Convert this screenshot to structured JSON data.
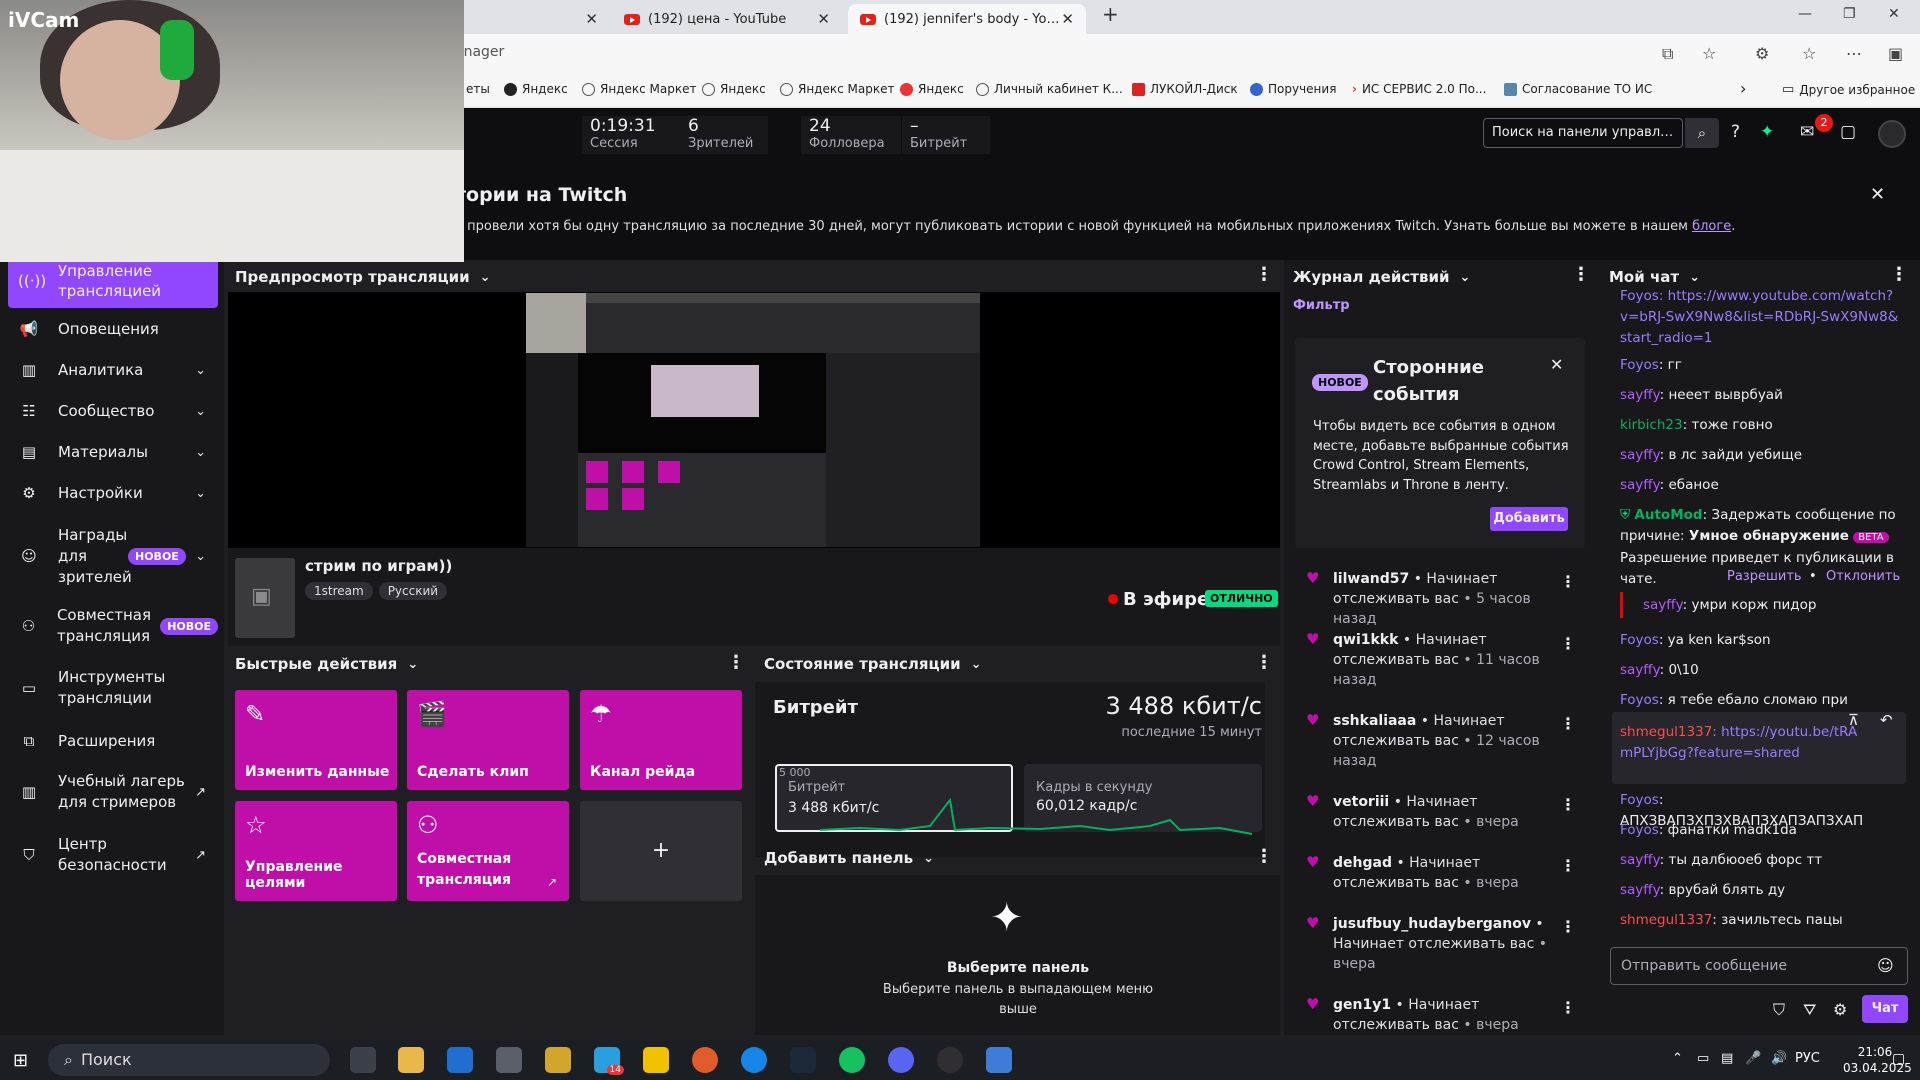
{
  "browser": {
    "tabs": [
      {
        "label": "(192) цена - YouTube"
      },
      {
        "label": "(192) jennifer's body - YouTube"
      }
    ],
    "address_partial": "anager",
    "bookmarks": [
      "еты",
      "Яндекс",
      "Яндекс Маркет",
      "Яндекс",
      "Яндекс Маркет",
      "Яндекс",
      "Личный кабинет К...",
      "ЛУКОЙЛ-Диск",
      "Поручения",
      "ИС СЕРВИС 2.0 По...",
      "Согласование ТО ИС",
      "Другое избранное"
    ]
  },
  "webcam_overlay": "iVCam",
  "stats": [
    {
      "value": "0:19:31",
      "label": "Сессия"
    },
    {
      "value": "6",
      "label": "Зрителей"
    },
    {
      "value": "24",
      "label": "Фолловера"
    },
    {
      "value": "–",
      "label": "Битрейт"
    }
  ],
  "search_placeholder": "Поиск на панели управлени",
  "notifications_count": "2",
  "banner": {
    "title": "тории на Twitch",
    "text": "е провели хотя бы одну трансляцию за последние 30 дней, могут публиковать истории с новой функцией на мобильных приложениях Twitch. Узнать больше вы можете в нашем",
    "link": "блоге",
    "after": "."
  },
  "sidebar": [
    {
      "label": "Управление трансляцией",
      "icon": "broadcast-icon",
      "active": true
    },
    {
      "label": "Оповещения",
      "icon": "megaphone-icon"
    },
    {
      "label": "Аналитика",
      "icon": "analytics-icon",
      "expand": true
    },
    {
      "label": "Сообщество",
      "icon": "community-icon",
      "expand": true
    },
    {
      "label": "Материалы",
      "icon": "content-icon",
      "expand": true
    },
    {
      "label": "Настройки",
      "icon": "gear-icon",
      "expand": true
    },
    {
      "label": "Награды для зрителей",
      "icon": "rewards-icon",
      "badge": "НОВОЕ",
      "expand": true
    },
    {
      "label": "Совместная трансляция",
      "icon": "collab-icon",
      "badge": "НОВОЕ"
    },
    {
      "label": "Инструменты трансляции",
      "icon": "tools-icon"
    },
    {
      "label": "Расширения",
      "icon": "extensions-icon"
    },
    {
      "label": "Учебный лагерь для стримеров",
      "icon": "book-icon",
      "external": true
    },
    {
      "label": "Центр безопасности",
      "icon": "shield-icon",
      "external": true
    }
  ],
  "preview": {
    "header": "Предпросмотр трансляции"
  },
  "stream": {
    "title": "стрим по играм))",
    "tags": [
      "1stream",
      "Русский"
    ],
    "live_label": "В эфире",
    "live_badge": "ОТЛИЧНО"
  },
  "quick_actions": {
    "header": "Быстрые действия",
    "items": [
      {
        "label": "Изменить данные",
        "icon": "pencil-icon"
      },
      {
        "label": "Сделать клип",
        "icon": "clapper-icon"
      },
      {
        "label": "Канал рейда",
        "icon": "raid-icon"
      },
      {
        "label": "Управление целями",
        "icon": "star-icon"
      },
      {
        "label": "Совместная трансляция",
        "icon": "add-user-icon"
      }
    ],
    "plus": "+"
  },
  "health": {
    "header": "Состояние трансляции",
    "title": "Битрейт",
    "value": "3 488 кбит/с",
    "sub": "последние 15 минут",
    "box1": {
      "top": "5 000",
      "label": "Битрейт",
      "value": "3 488 кбит/с"
    },
    "box2": {
      "label": "Кадры в секунду",
      "value": "60,012 кадр/с"
    }
  },
  "add_panel": {
    "header": "Добавить панель",
    "title": "Выберите панель",
    "text": "Выберите панель в выпадающем меню выше"
  },
  "activity": {
    "header": "Журнал действий",
    "filter": "Фильтр",
    "card": {
      "badge": "НОВОЕ",
      "title": "Сторонние события",
      "text": "Чтобы видеть все события в одном месте, добавьте выбранные события Crowd Control, Stream Elements, Streamlabs и Throne в ленту.",
      "button": "Добавить"
    },
    "events": [
      {
        "user": "lilwand57",
        "text": "• Начинает отслеживать вас",
        "time": "• 5 часов назад"
      },
      {
        "user": "qwi1kkk",
        "text": "• Начинает отслеживать вас",
        "time": "• 11 часов назад"
      },
      {
        "user": "sshkaliaaa",
        "text": "• Начинает отслеживать вас",
        "time": "• 12 часов назад"
      },
      {
        "user": "vetoriii",
        "text": "• Начинает отслеживать вас",
        "time": "• вчера"
      },
      {
        "user": "dehgad",
        "text": "• Начинает отслеживать вас",
        "time": "• вчера"
      },
      {
        "user": "jusufbuy_hudayberganov",
        "text": "• Начинает отслеживать вас",
        "time": "• вчера"
      },
      {
        "user": "gen1y1",
        "text": "• Начинает отслеживать вас",
        "time": "• вчера"
      }
    ]
  },
  "chat": {
    "header": "Мой чат",
    "messages": [
      {
        "user": "Foyos",
        "text": ": https://www.youtube.com/watch?v=bRJ-SwX9Nw8&list=RDbRJ-SwX9Nw8&start_radio=1"
      },
      {
        "user": "Foyos",
        "text": ": гг"
      },
      {
        "user": "sayffy",
        "text": ": нееет выврбуай"
      },
      {
        "user": "kirbich23",
        "text": ": тоже говно"
      },
      {
        "user": "sayffy",
        "text": ": в лс зайди уебище"
      },
      {
        "user": "sayffy",
        "text": ": ебаное"
      },
      {
        "user": "AutoMod",
        "text": ": Задержать сообщение по причине: ",
        "bold": "Умное обнаружение",
        "badge": "BETA",
        "rest": "Разрешение приведет к публикации в чате.",
        "allow": "Разрешить",
        "deny": "Отклонить"
      },
      {
        "user": "sayffy",
        "text": ": умри корж пидор"
      },
      {
        "user": "Foyos",
        "text": ": ya ken kar$son"
      },
      {
        "user": "sayffy",
        "text": ": 0\\10"
      },
      {
        "user": "Foyos",
        "text": ": я тебе ебало сломаю при встрече"
      },
      {
        "user": "shmegul1337",
        "text": ": https://youtu.be/tRAmPLYjbGg?feature=shared"
      },
      {
        "user": "Foyos",
        "text": ": АПХЗВАПЗХПЗХВАПЗХАПЗАПЗХАП"
      },
      {
        "user": "Foyos",
        "text": ": фанатки madk1da"
      },
      {
        "user": "sayffy",
        "text": ": ты далбюоеб форс тт"
      },
      {
        "user": "sayffy",
        "text": ": врубай блять ду"
      },
      {
        "user": "shmegul1337",
        "text": ": зачильтесь пацы"
      }
    ],
    "input_placeholder": "Отправить сообщение",
    "send": "Чат"
  },
  "taskbar": {
    "search": "Поиск",
    "lang": "РУС",
    "time": "21:06",
    "date": "03.04.2025",
    "telegram_count": "14"
  }
}
